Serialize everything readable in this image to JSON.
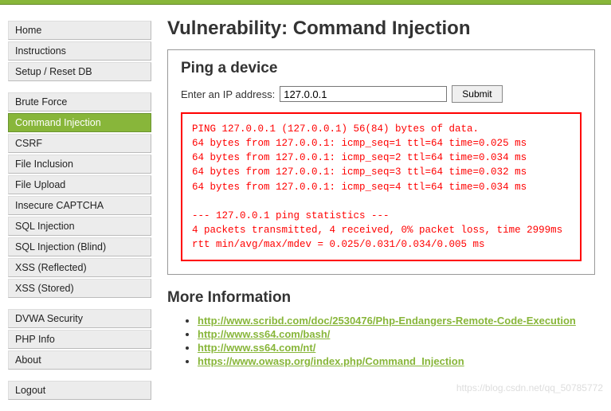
{
  "sidebar": {
    "groups": [
      {
        "items": [
          {
            "label": "Home",
            "selected": false
          },
          {
            "label": "Instructions",
            "selected": false
          },
          {
            "label": "Setup / Reset DB",
            "selected": false
          }
        ]
      },
      {
        "items": [
          {
            "label": "Brute Force",
            "selected": false
          },
          {
            "label": "Command Injection",
            "selected": true
          },
          {
            "label": "CSRF",
            "selected": false
          },
          {
            "label": "File Inclusion",
            "selected": false
          },
          {
            "label": "File Upload",
            "selected": false
          },
          {
            "label": "Insecure CAPTCHA",
            "selected": false
          },
          {
            "label": "SQL Injection",
            "selected": false
          },
          {
            "label": "SQL Injection (Blind)",
            "selected": false
          },
          {
            "label": "XSS (Reflected)",
            "selected": false
          },
          {
            "label": "XSS (Stored)",
            "selected": false
          }
        ]
      },
      {
        "items": [
          {
            "label": "DVWA Security",
            "selected": false
          },
          {
            "label": "PHP Info",
            "selected": false
          },
          {
            "label": "About",
            "selected": false
          }
        ]
      },
      {
        "items": [
          {
            "label": "Logout",
            "selected": false
          }
        ]
      }
    ]
  },
  "page": {
    "title": "Vulnerability: Command Injection"
  },
  "panel": {
    "title": "Ping a device",
    "input_label": "Enter an IP address:",
    "ip_value": "127.0.0.1",
    "submit_label": "Submit"
  },
  "output_lines": [
    "PING 127.0.0.1 (127.0.0.1) 56(84) bytes of data.",
    "64 bytes from 127.0.0.1: icmp_seq=1 ttl=64 time=0.025 ms",
    "64 bytes from 127.0.0.1: icmp_seq=2 ttl=64 time=0.034 ms",
    "64 bytes from 127.0.0.1: icmp_seq=3 ttl=64 time=0.032 ms",
    "64 bytes from 127.0.0.1: icmp_seq=4 ttl=64 time=0.034 ms",
    "",
    "--- 127.0.0.1 ping statistics ---",
    "4 packets transmitted, 4 received, 0% packet loss, time 2999ms",
    "rtt min/avg/max/mdev = 0.025/0.031/0.034/0.005 ms"
  ],
  "more_info": {
    "heading": "More Information",
    "links": [
      "http://www.scribd.com/doc/2530476/Php-Endangers-Remote-Code-Execution",
      "http://www.ss64.com/bash/",
      "http://www.ss64.com/nt/",
      "https://www.owasp.org/index.php/Command_Injection"
    ]
  },
  "watermark": "https://blog.csdn.net/qq_50785772"
}
